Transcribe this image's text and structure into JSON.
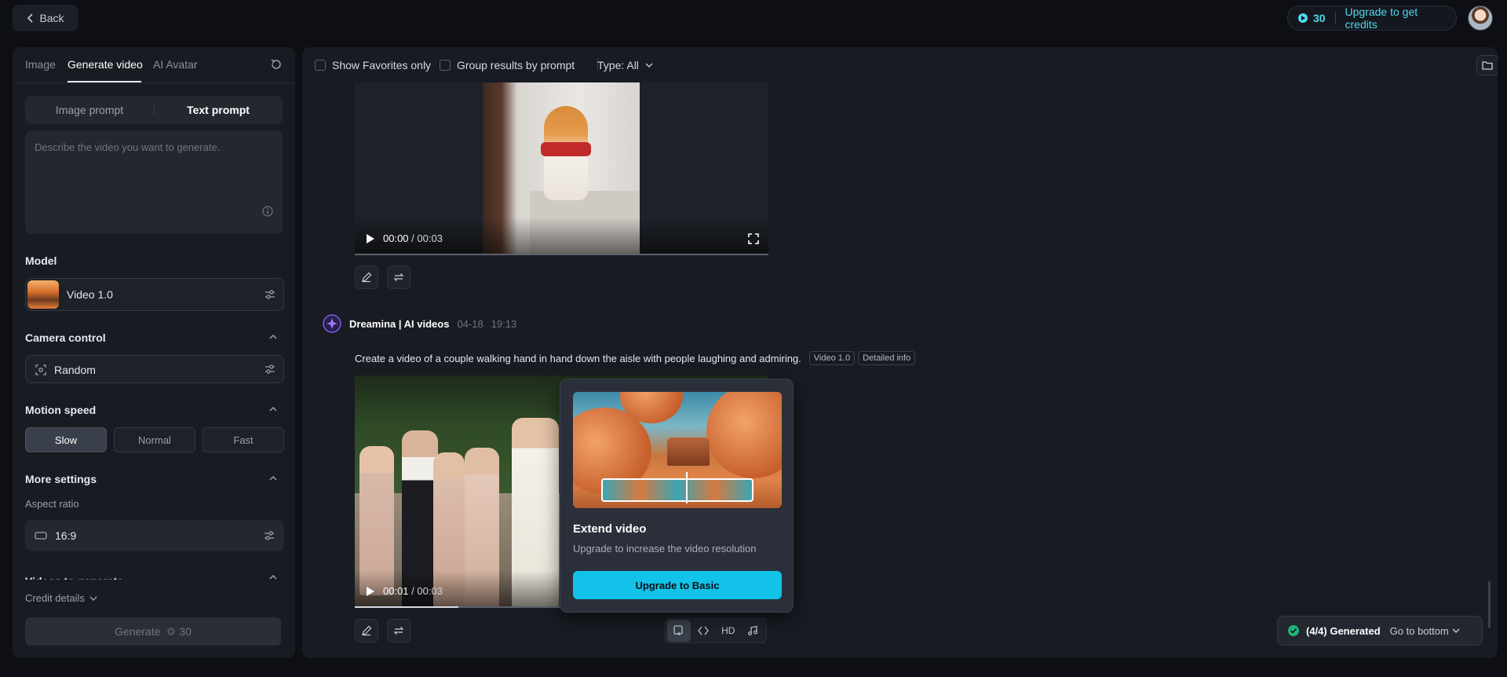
{
  "topbar": {
    "back_label": "Back",
    "credits": "30",
    "upgrade_label": "Upgrade to get credits"
  },
  "left": {
    "tabs": [
      {
        "label": "Image"
      },
      {
        "label": "Generate video"
      },
      {
        "label": "AI Avatar"
      }
    ],
    "prompt_tabs": [
      {
        "label": "Image prompt"
      },
      {
        "label": "Text prompt"
      }
    ],
    "prompt_placeholder": "Describe the video you want to generate.",
    "model_title": "Model",
    "model_name": "Video 1.0",
    "camera_title": "Camera control",
    "camera_value": "Random",
    "motion_title": "Motion speed",
    "motion_options": [
      {
        "label": "Slow"
      },
      {
        "label": "Normal"
      },
      {
        "label": "Fast"
      }
    ],
    "more_settings_title": "More settings",
    "aspect_label": "Aspect ratio",
    "aspect_value": "16:9",
    "videos_to_generate": "Videos to generate",
    "credit_details": "Credit details",
    "generate_label": "Generate",
    "generate_cost": "30"
  },
  "right": {
    "filters": {
      "favorites": "Show Favorites only",
      "group": "Group results by prompt",
      "type": "Type: All"
    },
    "video1": {
      "time_current": "00:00",
      "time_total": "/ 00:03"
    },
    "entry": {
      "author": "Dreamina | AI videos",
      "date": "04-18",
      "time": "19:13",
      "prompt": "Create a video of a couple walking hand in hand down the aisle with people laughing and admiring.",
      "tag_model": "Video 1.0",
      "tag_detail": "Detailed info"
    },
    "video2": {
      "time_current": "00:01",
      "time_total": "/ 00:03",
      "progress": 0.25
    },
    "popover": {
      "title": "Extend video",
      "subtitle": "Upgrade to increase the video resolution",
      "button": "Upgrade to Basic"
    },
    "tools": {
      "hd": "HD"
    },
    "status": {
      "generated": "(4/4) Generated",
      "goto": "Go to bottom"
    }
  }
}
